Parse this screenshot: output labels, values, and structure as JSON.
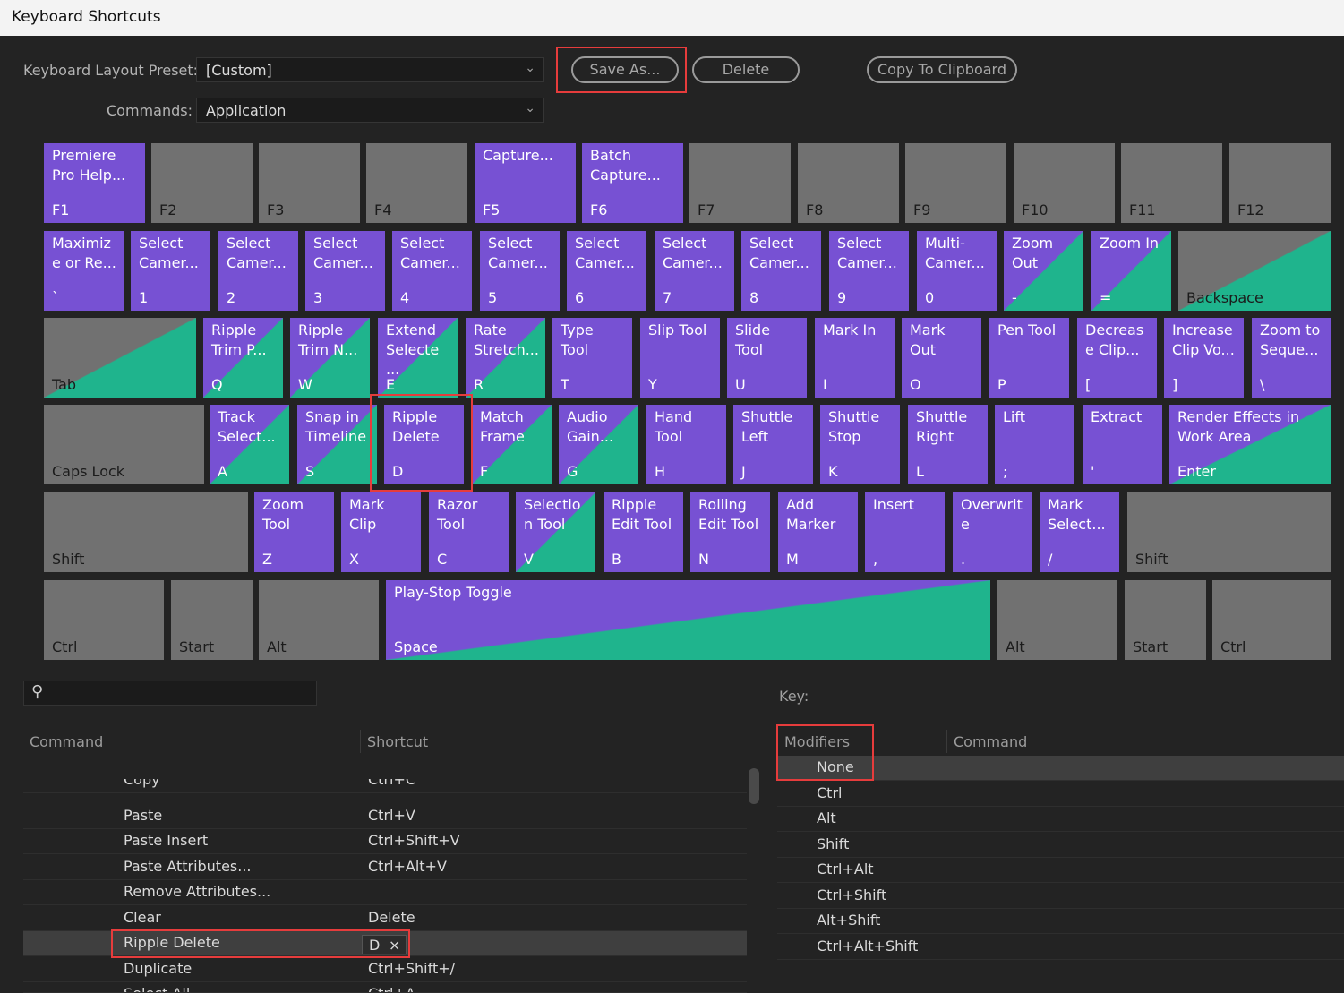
{
  "window": {
    "title": "Keyboard Shortcuts"
  },
  "toolbar": {
    "preset_label": "Keyboard Layout Preset:",
    "preset_value": "[Custom]",
    "commands_label": "Commands:",
    "commands_value": "Application",
    "save_as": "Save As...",
    "delete": "Delete",
    "copy_clipboard": "Copy To Clipboard"
  },
  "keyboard": {
    "rows": [
      [
        {
          "key": "F1",
          "cmd": "Premiere\nPro Help...",
          "style": "p"
        },
        {
          "key": "F2",
          "cmd": "",
          "style": "g"
        },
        {
          "key": "F3",
          "cmd": "",
          "style": "g"
        },
        {
          "key": "F4",
          "cmd": "",
          "style": "g"
        },
        {
          "key": "F5",
          "cmd": "Capture...",
          "style": "p"
        },
        {
          "key": "F6",
          "cmd": "Batch\nCapture...",
          "style": "p"
        },
        {
          "key": "F7",
          "cmd": "",
          "style": "g"
        },
        {
          "key": "F8",
          "cmd": "",
          "style": "g"
        },
        {
          "key": "F9",
          "cmd": "",
          "style": "g"
        },
        {
          "key": "F10",
          "cmd": "",
          "style": "g"
        },
        {
          "key": "F11",
          "cmd": "",
          "style": "g"
        },
        {
          "key": "F12",
          "cmd": "",
          "style": "g"
        }
      ],
      [
        {
          "key": "`",
          "cmd": "Maximiz\ne or Re...",
          "style": "p"
        },
        {
          "key": "1",
          "cmd": "Select\nCamer...",
          "style": "p"
        },
        {
          "key": "2",
          "cmd": "Select\nCamer...",
          "style": "p"
        },
        {
          "key": "3",
          "cmd": "Select\nCamer...",
          "style": "p"
        },
        {
          "key": "4",
          "cmd": "Select\nCamer...",
          "style": "p"
        },
        {
          "key": "5",
          "cmd": "Select\nCamer...",
          "style": "p"
        },
        {
          "key": "6",
          "cmd": "Select\nCamer...",
          "style": "p"
        },
        {
          "key": "7",
          "cmd": "Select\nCamer...",
          "style": "p"
        },
        {
          "key": "8",
          "cmd": "Select\nCamer...",
          "style": "p"
        },
        {
          "key": "9",
          "cmd": "Select\nCamer...",
          "style": "p"
        },
        {
          "key": "0",
          "cmd": "Multi-\nCamer...",
          "style": "p"
        },
        {
          "key": "-",
          "cmd": "Zoom\nOut",
          "style": "ps"
        },
        {
          "key": "=",
          "cmd": "Zoom In",
          "style": "ps"
        },
        {
          "key": "Backspace",
          "cmd": "",
          "style": "gs"
        }
      ],
      [
        {
          "key": "Tab",
          "cmd": "",
          "style": "gs"
        },
        {
          "key": "Q",
          "cmd": "Ripple\nTrim P...",
          "style": "ps"
        },
        {
          "key": "W",
          "cmd": "Ripple\nTrim N...",
          "style": "ps"
        },
        {
          "key": "E",
          "cmd": "Extend\nSelecte\n...",
          "style": "ps"
        },
        {
          "key": "R",
          "cmd": "Rate\nStretch...",
          "style": "ps"
        },
        {
          "key": "T",
          "cmd": "Type\nTool",
          "style": "p"
        },
        {
          "key": "Y",
          "cmd": "Slip Tool",
          "style": "p"
        },
        {
          "key": "U",
          "cmd": "Slide\nTool",
          "style": "p"
        },
        {
          "key": "I",
          "cmd": "Mark In",
          "style": "p"
        },
        {
          "key": "O",
          "cmd": "Mark\nOut",
          "style": "p"
        },
        {
          "key": "P",
          "cmd": "Pen Tool",
          "style": "p"
        },
        {
          "key": "[",
          "cmd": "Decreas\ne Clip...",
          "style": "p"
        },
        {
          "key": "]",
          "cmd": "Increase\nClip Vo...",
          "style": "p"
        },
        {
          "key": "\\",
          "cmd": "Zoom to\nSeque...",
          "style": "p"
        }
      ],
      [
        {
          "key": "Caps Lock",
          "cmd": "",
          "style": "g"
        },
        {
          "key": "A",
          "cmd": "Track\nSelect...",
          "style": "ps"
        },
        {
          "key": "S",
          "cmd": "Snap in\nTimeline",
          "style": "ps"
        },
        {
          "key": "D",
          "cmd": "Ripple\nDelete",
          "style": "p"
        },
        {
          "key": "F",
          "cmd": "Match\nFrame",
          "style": "ps"
        },
        {
          "key": "G",
          "cmd": "Audio\nGain...",
          "style": "ps"
        },
        {
          "key": "H",
          "cmd": "Hand\nTool",
          "style": "p"
        },
        {
          "key": "J",
          "cmd": "Shuttle\nLeft",
          "style": "p"
        },
        {
          "key": "K",
          "cmd": "Shuttle\nStop",
          "style": "p"
        },
        {
          "key": "L",
          "cmd": "Shuttle\nRight",
          "style": "p"
        },
        {
          "key": ";",
          "cmd": "Lift",
          "style": "p"
        },
        {
          "key": "'",
          "cmd": "Extract",
          "style": "p"
        },
        {
          "key": "Enter",
          "cmd": "Render Effects in\nWork Area",
          "style": "ps"
        }
      ],
      [
        {
          "key": "Shift",
          "cmd": "",
          "style": "g"
        },
        {
          "key": "Z",
          "cmd": "Zoom\nTool",
          "style": "p"
        },
        {
          "key": "X",
          "cmd": "Mark\nClip",
          "style": "p"
        },
        {
          "key": "C",
          "cmd": "Razor\nTool",
          "style": "p"
        },
        {
          "key": "V",
          "cmd": "Selectio\nn Tool",
          "style": "ps"
        },
        {
          "key": "B",
          "cmd": "Ripple\nEdit Tool",
          "style": "p"
        },
        {
          "key": "N",
          "cmd": "Rolling\nEdit Tool",
          "style": "p"
        },
        {
          "key": "M",
          "cmd": "Add\nMarker",
          "style": "p"
        },
        {
          "key": ",",
          "cmd": "Insert",
          "style": "p"
        },
        {
          "key": ".",
          "cmd": "Overwrit\ne",
          "style": "p"
        },
        {
          "key": "/",
          "cmd": "Mark\nSelect...",
          "style": "p"
        },
        {
          "key": "Shift",
          "cmd": "",
          "style": "g"
        }
      ],
      [
        {
          "key": "Ctrl",
          "cmd": "",
          "style": "g"
        },
        {
          "key": "Start",
          "cmd": "",
          "style": "g"
        },
        {
          "key": "Alt",
          "cmd": "",
          "style": "g"
        },
        {
          "key": "Space",
          "cmd": "Play-Stop Toggle",
          "style": "ps"
        },
        {
          "key": "Alt",
          "cmd": "",
          "style": "g"
        },
        {
          "key": "Start",
          "cmd": "",
          "style": "g"
        },
        {
          "key": "Ctrl",
          "cmd": "",
          "style": "g"
        }
      ]
    ]
  },
  "commands_table": {
    "header_command": "Command",
    "header_shortcut": "Shortcut",
    "rows": [
      {
        "command": "Copy",
        "shortcut": "Ctrl+C"
      },
      {
        "command": "Paste",
        "shortcut": "Ctrl+V"
      },
      {
        "command": "Paste Insert",
        "shortcut": "Ctrl+Shift+V"
      },
      {
        "command": "Paste Attributes...",
        "shortcut": "Ctrl+Alt+V"
      },
      {
        "command": "Remove Attributes...",
        "shortcut": ""
      },
      {
        "command": "Clear",
        "shortcut": "Delete"
      },
      {
        "command": "Ripple Delete",
        "shortcut": ""
      },
      {
        "command": "Duplicate",
        "shortcut": "Ctrl+Shift+/"
      },
      {
        "command": "Select All",
        "shortcut": "Ctrl+A"
      }
    ],
    "selected_chip_key": "D",
    "selected_chip_close": "×"
  },
  "key_panel": {
    "title": "Key:",
    "header_modifiers": "Modifiers",
    "header_command": "Command",
    "modifiers": [
      "None",
      "Ctrl",
      "Alt",
      "Shift",
      "Ctrl+Alt",
      "Ctrl+Shift",
      "Alt+Shift",
      "Ctrl+Alt+Shift"
    ]
  }
}
